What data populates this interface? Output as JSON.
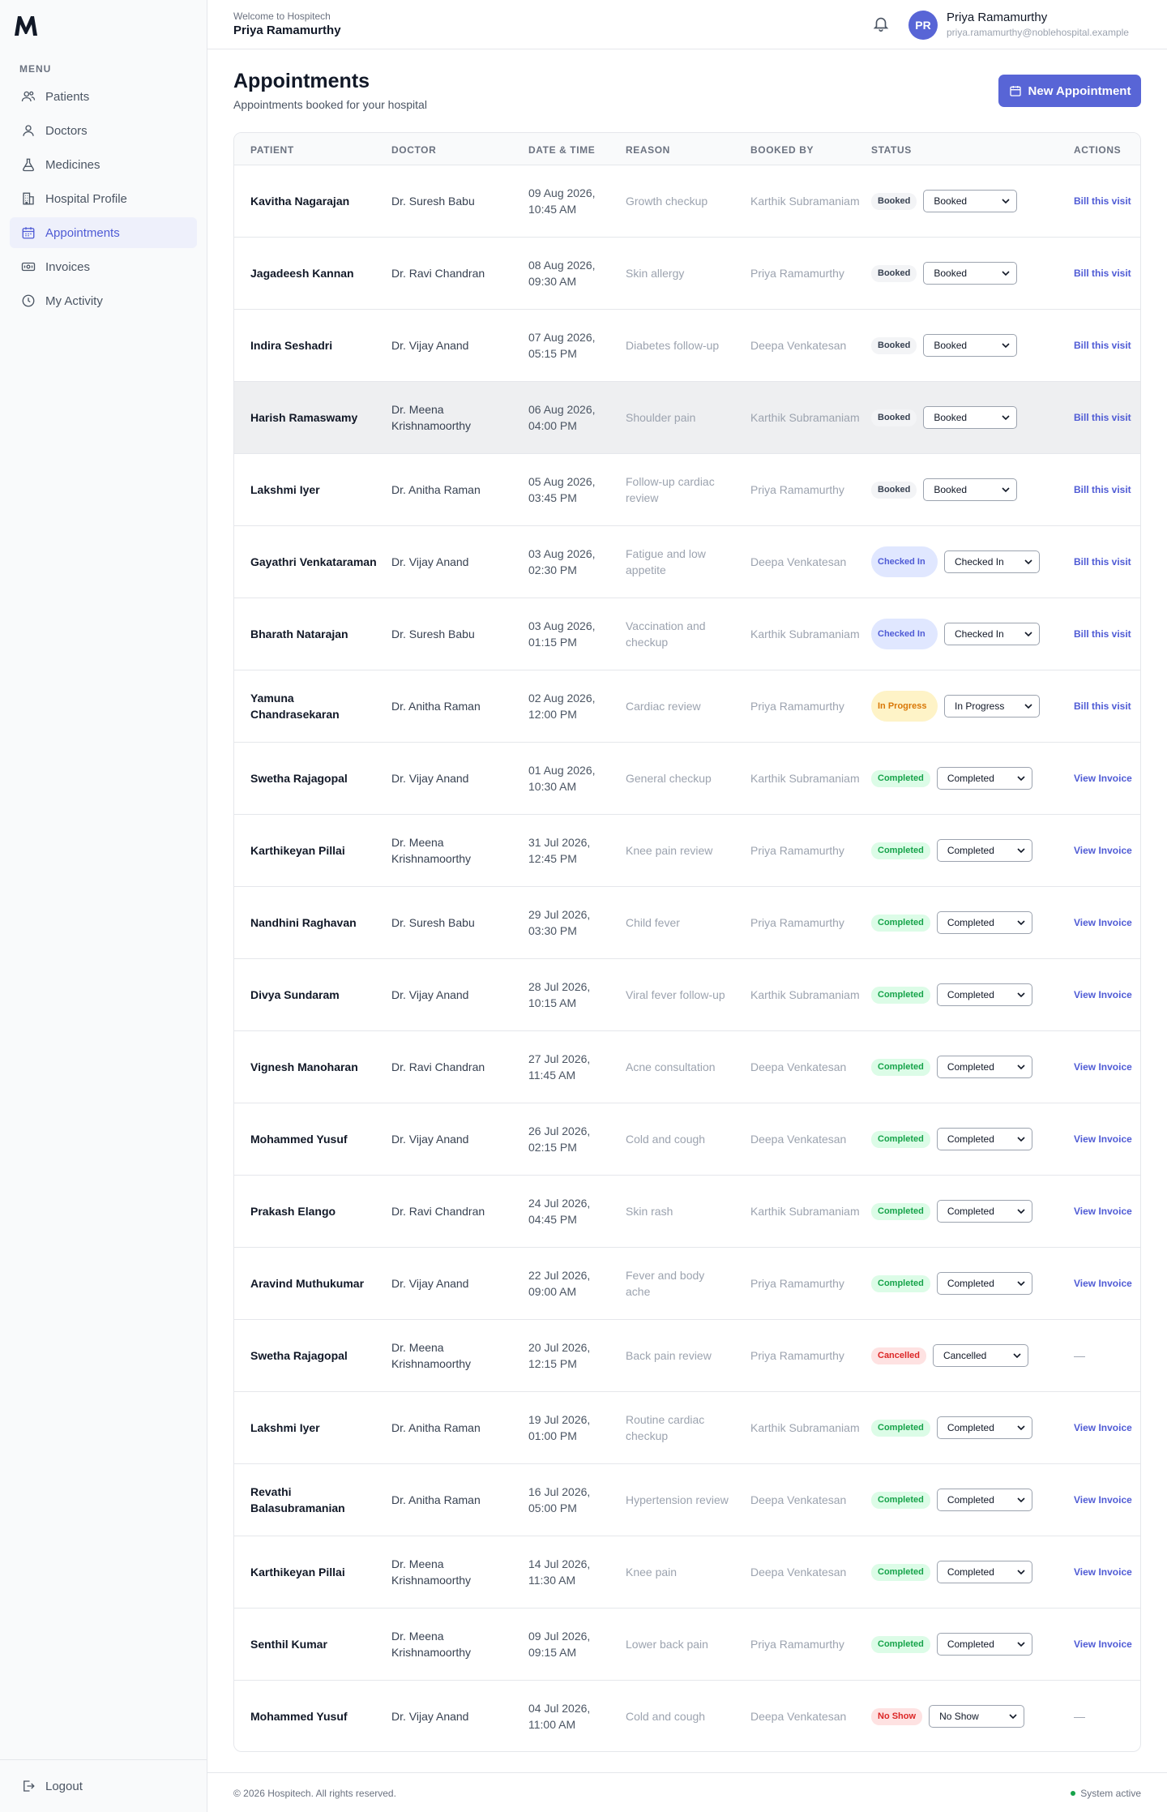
{
  "header": {
    "welcome": "Welcome to Hospitech",
    "name": "Priya Ramamurthy",
    "user": {
      "initials": "PR",
      "name": "Priya Ramamurthy",
      "email": "priya.ramamurthy@noblehospital.example"
    }
  },
  "sidebar": {
    "menu_label": "MENU",
    "items": [
      {
        "label": "Patients",
        "icon": "users-icon"
      },
      {
        "label": "Doctors",
        "icon": "user-icon"
      },
      {
        "label": "Medicines",
        "icon": "flask-icon"
      },
      {
        "label": "Hospital Profile",
        "icon": "building-icon"
      },
      {
        "label": "Appointments",
        "icon": "calendar-icon",
        "active": true
      },
      {
        "label": "Invoices",
        "icon": "banknote-icon"
      },
      {
        "label": "My Activity",
        "icon": "clock-icon"
      }
    ],
    "logout": "Logout"
  },
  "page": {
    "title": "Appointments",
    "subtitle": "Appointments booked for your hospital",
    "new_button": "New Appointment"
  },
  "table": {
    "headers": [
      "PATIENT",
      "DOCTOR",
      "DATE & TIME",
      "REASON",
      "BOOKED BY",
      "STATUS",
      "ACTIONS"
    ],
    "rows": [
      {
        "patient": "Kavitha Nagarajan",
        "doctor": "Dr. Suresh Babu",
        "datetime": "09 Aug 2026, 10:45 AM",
        "reason": "Growth checkup",
        "booked_by": "Karthik Subramaniam",
        "status": "Booked",
        "select": "Booked",
        "action": "Bill this visit"
      },
      {
        "patient": "Jagadeesh Kannan",
        "doctor": "Dr. Ravi Chandran",
        "datetime": "08 Aug 2026, 09:30 AM",
        "reason": "Skin allergy",
        "booked_by": "Priya Ramamurthy",
        "status": "Booked",
        "select": "Booked",
        "action": "Bill this visit"
      },
      {
        "patient": "Indira Seshadri",
        "doctor": "Dr. Vijay Anand",
        "datetime": "07 Aug 2026, 05:15 PM",
        "reason": "Diabetes follow-up",
        "booked_by": "Deepa Venkatesan",
        "status": "Booked",
        "select": "Booked",
        "action": "Bill this visit"
      },
      {
        "patient": "Harish Ramaswamy",
        "doctor": "Dr. Meena Krishnamoorthy",
        "datetime": "06 Aug 2026, 04:00 PM",
        "reason": "Shoulder pain",
        "booked_by": "Karthik Subramaniam",
        "status": "Booked",
        "select": "Booked",
        "action": "Bill this visit",
        "highlight": true
      },
      {
        "patient": "Lakshmi Iyer",
        "doctor": "Dr. Anitha Raman",
        "datetime": "05 Aug 2026, 03:45 PM",
        "reason": "Follow-up cardiac review",
        "booked_by": "Priya Ramamurthy",
        "status": "Booked",
        "select": "Booked",
        "action": "Bill this visit"
      },
      {
        "patient": "Gayathri Venkataraman",
        "doctor": "Dr. Vijay Anand",
        "datetime": "03 Aug 2026, 02:30 PM",
        "reason": "Fatigue and low appetite",
        "booked_by": "Deepa Venkatesan",
        "status": "Checked In",
        "select": "Checked In",
        "action": "Bill this visit"
      },
      {
        "patient": "Bharath Natarajan",
        "doctor": "Dr. Suresh Babu",
        "datetime": "03 Aug 2026, 01:15 PM",
        "reason": "Vaccination and checkup",
        "booked_by": "Karthik Subramaniam",
        "status": "Checked In",
        "select": "Checked In",
        "action": "Bill this visit"
      },
      {
        "patient": "Yamuna Chandrasekaran",
        "doctor": "Dr. Anitha Raman",
        "datetime": "02 Aug 2026, 12:00 PM",
        "reason": "Cardiac review",
        "booked_by": "Priya Ramamurthy",
        "status": "In Progress",
        "select": "In Progress",
        "action": "Bill this visit"
      },
      {
        "patient": "Swetha Rajagopal",
        "doctor": "Dr. Vijay Anand",
        "datetime": "01 Aug 2026, 10:30 AM",
        "reason": "General checkup",
        "booked_by": "Karthik Subramaniam",
        "status": "Completed",
        "select": "Completed",
        "action": "View Invoice"
      },
      {
        "patient": "Karthikeyan Pillai",
        "doctor": "Dr. Meena Krishnamoorthy",
        "datetime": "31 Jul 2026, 12:45 PM",
        "reason": "Knee pain review",
        "booked_by": "Priya Ramamurthy",
        "status": "Completed",
        "select": "Completed",
        "action": "View Invoice"
      },
      {
        "patient": "Nandhini Raghavan",
        "doctor": "Dr. Suresh Babu",
        "datetime": "29 Jul 2026, 03:30 PM",
        "reason": "Child fever",
        "booked_by": "Priya Ramamurthy",
        "status": "Completed",
        "select": "Completed",
        "action": "View Invoice"
      },
      {
        "patient": "Divya Sundaram",
        "doctor": "Dr. Vijay Anand",
        "datetime": "28 Jul 2026, 10:15 AM",
        "reason": "Viral fever follow-up",
        "booked_by": "Karthik Subramaniam",
        "status": "Completed",
        "select": "Completed",
        "action": "View Invoice"
      },
      {
        "patient": "Vignesh Manoharan",
        "doctor": "Dr. Ravi Chandran",
        "datetime": "27 Jul 2026, 11:45 AM",
        "reason": "Acne consultation",
        "booked_by": "Deepa Venkatesan",
        "status": "Completed",
        "select": "Completed",
        "action": "View Invoice"
      },
      {
        "patient": "Mohammed Yusuf",
        "doctor": "Dr. Vijay Anand",
        "datetime": "26 Jul 2026, 02:15 PM",
        "reason": "Cold and cough",
        "booked_by": "Deepa Venkatesan",
        "status": "Completed",
        "select": "Completed",
        "action": "View Invoice"
      },
      {
        "patient": "Prakash Elango",
        "doctor": "Dr. Ravi Chandran",
        "datetime": "24 Jul 2026, 04:45 PM",
        "reason": "Skin rash",
        "booked_by": "Karthik Subramaniam",
        "status": "Completed",
        "select": "Completed",
        "action": "View Invoice"
      },
      {
        "patient": "Aravind Muthukumar",
        "doctor": "Dr. Vijay Anand",
        "datetime": "22 Jul 2026, 09:00 AM",
        "reason": "Fever and body ache",
        "booked_by": "Priya Ramamurthy",
        "status": "Completed",
        "select": "Completed",
        "action": "View Invoice"
      },
      {
        "patient": "Swetha Rajagopal",
        "doctor": "Dr. Meena Krishnamoorthy",
        "datetime": "20 Jul 2026, 12:15 PM",
        "reason": "Back pain review",
        "booked_by": "Priya Ramamurthy",
        "status": "Cancelled",
        "select": "Cancelled",
        "action": "—"
      },
      {
        "patient": "Lakshmi Iyer",
        "doctor": "Dr. Anitha Raman",
        "datetime": "19 Jul 2026, 01:00 PM",
        "reason": "Routine cardiac checkup",
        "booked_by": "Karthik Subramaniam",
        "status": "Completed",
        "select": "Completed",
        "action": "View Invoice"
      },
      {
        "patient": "Revathi Balasubramanian",
        "doctor": "Dr. Anitha Raman",
        "datetime": "16 Jul 2026, 05:00 PM",
        "reason": "Hypertension review",
        "booked_by": "Deepa Venkatesan",
        "status": "Completed",
        "select": "Completed",
        "action": "View Invoice"
      },
      {
        "patient": "Karthikeyan Pillai",
        "doctor": "Dr. Meena Krishnamoorthy",
        "datetime": "14 Jul 2026, 11:30 AM",
        "reason": "Knee pain",
        "booked_by": "Deepa Venkatesan",
        "status": "Completed",
        "select": "Completed",
        "action": "View Invoice"
      },
      {
        "patient": "Senthil Kumar",
        "doctor": "Dr. Meena Krishnamoorthy",
        "datetime": "09 Jul 2026, 09:15 AM",
        "reason": "Lower back pain",
        "booked_by": "Priya Ramamurthy",
        "status": "Completed",
        "select": "Completed",
        "action": "View Invoice"
      },
      {
        "patient": "Mohammed Yusuf",
        "doctor": "Dr. Vijay Anand",
        "datetime": "04 Jul 2026, 11:00 AM",
        "reason": "Cold and cough",
        "booked_by": "Deepa Venkatesan",
        "status": "No Show",
        "select": "No Show",
        "action": "—"
      }
    ]
  },
  "footer": {
    "copyright": "© 2026 Hospitech. All rights reserved.",
    "system": "System active"
  },
  "colors": {
    "accent": "#5865d6",
    "booked": "#f3f4f6",
    "checked_in": "#e0e7ff",
    "in_progress": "#fef3c7",
    "completed": "#dcfce7",
    "cancelled": "#fee2e2"
  }
}
